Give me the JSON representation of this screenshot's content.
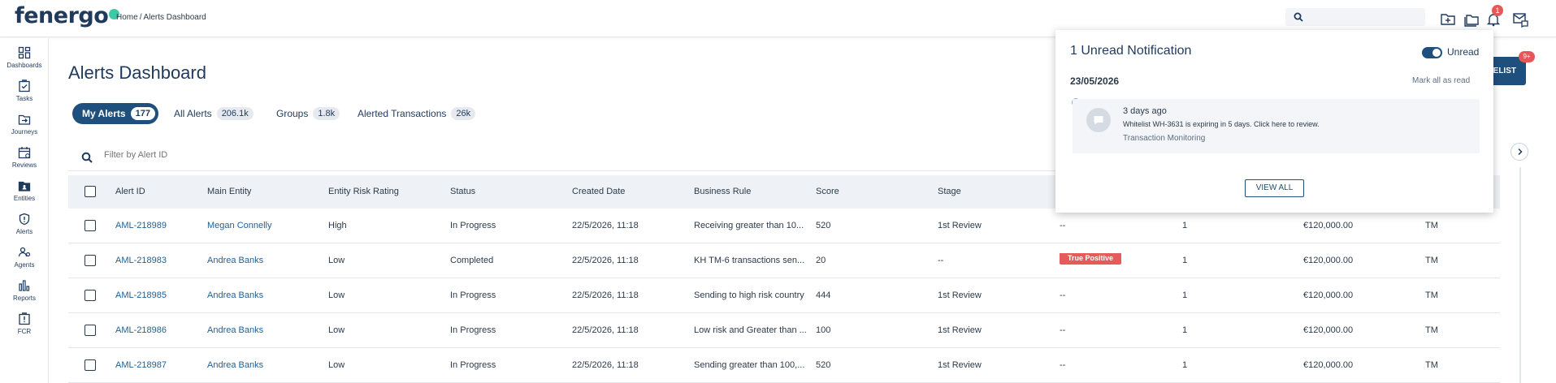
{
  "brand": {
    "logo_text": "fenergo",
    "accent": "#3fc7a8",
    "primary": "#1f4f7d"
  },
  "breadcrumb": {
    "home": "Home",
    "separator": "/",
    "current": "Alerts Dashboard"
  },
  "topbar": {
    "search_placeholder": "",
    "notification_count": "1",
    "icons": [
      "search-icon",
      "folder-add-icon",
      "folders-icon",
      "bell-icon",
      "inbox-icon"
    ]
  },
  "sidebar": {
    "items": [
      {
        "label": "Dashboards",
        "icon": "grid-icon"
      },
      {
        "label": "Tasks",
        "icon": "checklist-icon"
      },
      {
        "label": "Journeys",
        "icon": "folder-arrow-icon"
      },
      {
        "label": "Reviews",
        "icon": "calendar-icon"
      },
      {
        "label": "Entities",
        "icon": "folder-person-icon"
      },
      {
        "label": "Alerts",
        "icon": "shield-icon"
      },
      {
        "label": "Agents",
        "icon": "agents-icon"
      },
      {
        "label": "Reports",
        "icon": "bar-chart-icon"
      },
      {
        "label": "FCR",
        "icon": "fcr-icon"
      }
    ]
  },
  "page": {
    "title": "Alerts Dashboard"
  },
  "tabs": [
    {
      "label": "My Alerts",
      "count": "177",
      "active": true
    },
    {
      "label": "All Alerts",
      "count": "206.1k",
      "active": false
    },
    {
      "label": "Groups",
      "count": "1.8k",
      "active": false
    },
    {
      "label": "Alerted Transactions",
      "count": "26k",
      "active": false
    }
  ],
  "filter": {
    "placeholder": "Filter by Alert ID"
  },
  "whitelist_button": {
    "label": "ELIST",
    "badge": "9+"
  },
  "table": {
    "headers": [
      "Alert ID",
      "Main Entity",
      "Entity Risk Rating",
      "Status",
      "Created Date",
      "Business Rule",
      "Score",
      "Stage"
    ],
    "rows": [
      {
        "id": "AML-218989",
        "entity": "Megan Connelly",
        "risk": "High",
        "status": "In Progress",
        "created": "22/5/2026, 11:18",
        "rule": "Receiving greater than 10...",
        "score": "520",
        "stage": "1st Review",
        "outcome": "--",
        "outcome_pill": false,
        "count": "1",
        "amount": "€120,000.00",
        "type": "TM"
      },
      {
        "id": "AML-218983",
        "entity": "Andrea Banks",
        "risk": "Low",
        "status": "Completed",
        "created": "22/5/2026, 11:18",
        "rule": "KH TM-6 transactions sen...",
        "score": "20",
        "stage": "--",
        "outcome": "True Positive",
        "outcome_pill": true,
        "count": "1",
        "amount": "€120,000.00",
        "type": "TM"
      },
      {
        "id": "AML-218985",
        "entity": "Andrea Banks",
        "risk": "Low",
        "status": "In Progress",
        "created": "22/5/2026, 11:18",
        "rule": "Sending to high risk country",
        "score": "444",
        "stage": "1st Review",
        "outcome": "--",
        "outcome_pill": false,
        "count": "1",
        "amount": "€120,000.00",
        "type": "TM"
      },
      {
        "id": "AML-218986",
        "entity": "Andrea Banks",
        "risk": "Low",
        "status": "In Progress",
        "created": "22/5/2026, 11:18",
        "rule": "Low risk and Greater than ...",
        "score": "100",
        "stage": "1st Review",
        "outcome": "--",
        "outcome_pill": false,
        "count": "1",
        "amount": "€120,000.00",
        "type": "TM"
      },
      {
        "id": "AML-218987",
        "entity": "Andrea Banks",
        "risk": "Low",
        "status": "In Progress",
        "created": "22/5/2026, 11:18",
        "rule": "Sending greater than 100,...",
        "score": "520",
        "stage": "1st Review",
        "outcome": "--",
        "outcome_pill": false,
        "count": "1",
        "amount": "€120,000.00",
        "type": "TM"
      }
    ]
  },
  "notifications": {
    "title": "1 Unread Notification",
    "toggle_label": "Unread",
    "date": "23/05/2026",
    "mark_all": "Mark all as read",
    "item": {
      "time": "3 days ago",
      "message": "Whitelist WH-3631 is expiring in 5 days. Click here to review.",
      "category": "Transaction Monitoring"
    },
    "view_all": "VIEW ALL"
  }
}
